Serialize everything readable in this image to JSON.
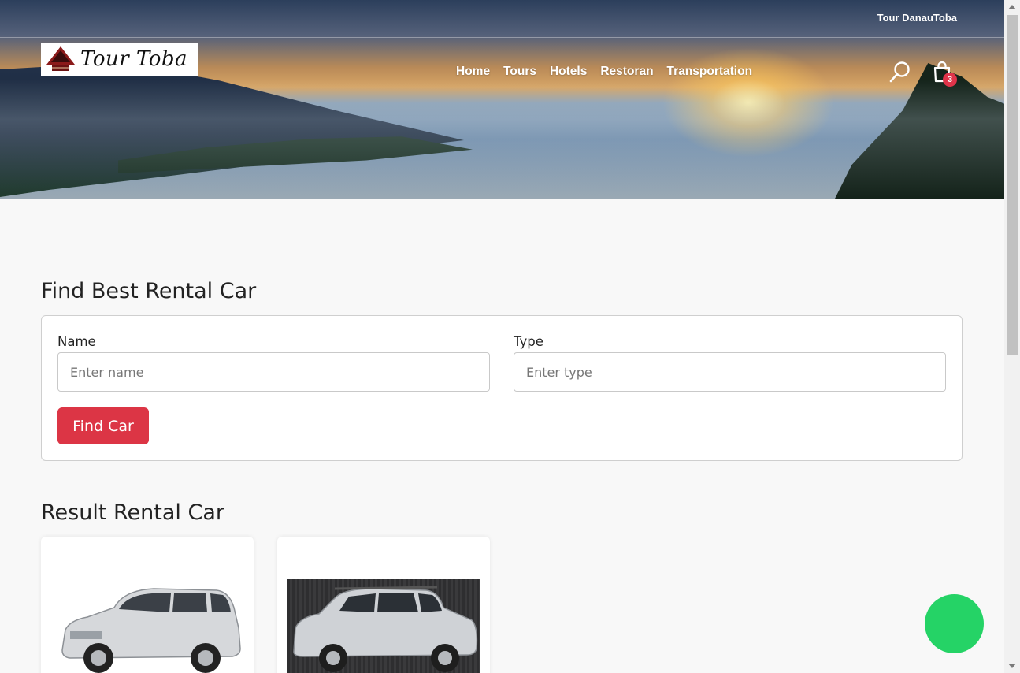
{
  "header": {
    "topbar_link": "Tour DanauToba",
    "logo_text": "Tour Toba",
    "nav": [
      "Home",
      "Tours",
      "Hotels",
      "Restoran",
      "Transportation"
    ],
    "cart_count": "3"
  },
  "search": {
    "title": "Find Best Rental Car",
    "name_label": "Name",
    "name_placeholder": "Enter name",
    "type_label": "Type",
    "type_placeholder": "Enter type",
    "button_label": "Find Car"
  },
  "results": {
    "title": "Result Rental Car",
    "cards": [
      {
        "icon": "minivan-silver-image"
      },
      {
        "icon": "suv-silver-image"
      }
    ]
  },
  "colors": {
    "accent": "#dc3545",
    "badge": "#e0344a",
    "whatsapp": "#25d366"
  }
}
